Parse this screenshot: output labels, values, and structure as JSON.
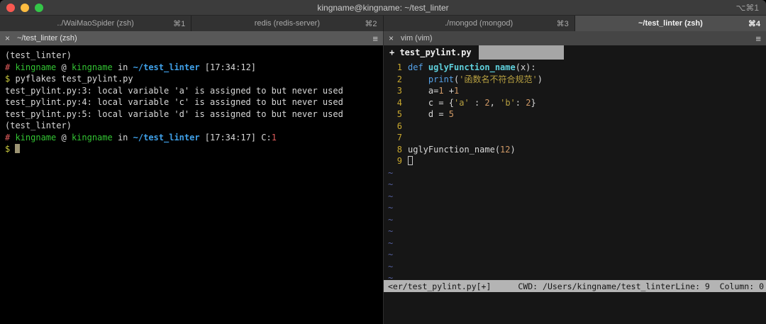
{
  "window": {
    "title": "kingname@kingname: ~/test_linter",
    "shortcut": "⌥⌘1"
  },
  "tabs": [
    {
      "label": "../WaiMaoSpider (zsh)",
      "shortcut": "⌘1",
      "active": false
    },
    {
      "label": "redis (redis-server)",
      "shortcut": "⌘2",
      "active": false
    },
    {
      "label": "./mongod (mongod)",
      "shortcut": "⌘3",
      "active": false
    },
    {
      "label": "~/test_linter (zsh)",
      "shortcut": "⌘4",
      "active": true
    }
  ],
  "left_pane": {
    "title": "~/test_linter (zsh)",
    "close_label": "×",
    "menu_icon": "≡",
    "lines": [
      [
        {
          "t": "(test_linter)",
          "c": "fg"
        }
      ],
      [
        {
          "t": "# ",
          "c": "red"
        },
        {
          "t": "kingname",
          "c": "green"
        },
        {
          "t": " @ ",
          "c": "fg"
        },
        {
          "t": "kingname",
          "c": "green"
        },
        {
          "t": " in ",
          "c": "fg"
        },
        {
          "t": "~/test_linter",
          "c": "path"
        },
        {
          "t": " [17:34:12]",
          "c": "fg"
        }
      ],
      [
        {
          "t": "$",
          "c": "yellow"
        },
        {
          "t": " pyflakes test_pylint.py",
          "c": "fg"
        }
      ],
      [
        {
          "t": "test_pylint.py:3: local variable 'a' is assigned to but never used",
          "c": "fg"
        }
      ],
      [
        {
          "t": "test_pylint.py:4: local variable 'c' is assigned to but never used",
          "c": "fg"
        }
      ],
      [
        {
          "t": "test_pylint.py:5: local variable 'd' is assigned to but never used",
          "c": "fg"
        }
      ],
      [
        {
          "t": "(test_linter)",
          "c": "fg"
        }
      ],
      [
        {
          "t": "# ",
          "c": "red"
        },
        {
          "t": "kingname",
          "c": "green"
        },
        {
          "t": " @ ",
          "c": "fg"
        },
        {
          "t": "kingname",
          "c": "green"
        },
        {
          "t": " in ",
          "c": "fg"
        },
        {
          "t": "~/test_linter",
          "c": "path"
        },
        {
          "t": " [17:34:17] ",
          "c": "fg"
        },
        {
          "t": "C:",
          "c": "fg"
        },
        {
          "t": "1",
          "c": "red"
        }
      ],
      [
        {
          "t": "$",
          "c": "yellow"
        },
        {
          "t": " ",
          "c": "fg"
        },
        {
          "cursor": "block"
        }
      ]
    ]
  },
  "right_pane": {
    "title": "vim (vim)",
    "close_label": "×",
    "menu_icon": "≡",
    "vim": {
      "tab_label": "+ test_pylint.py",
      "code_lines": [
        {
          "num": "1",
          "segs": [
            {
              "t": "def ",
              "c": "kw"
            },
            {
              "t": "uglyFunction_name",
              "c": "func"
            },
            {
              "t": "(x):",
              "c": "fg"
            }
          ]
        },
        {
          "num": "2",
          "segs": [
            {
              "t": "    ",
              "c": "fg"
            },
            {
              "t": "print",
              "c": "kw"
            },
            {
              "t": "(",
              "c": "fg"
            },
            {
              "t": "'函数名不符合规范'",
              "c": "str"
            },
            {
              "t": ")",
              "c": "fg"
            }
          ]
        },
        {
          "num": "3",
          "segs": [
            {
              "t": "    a=",
              "c": "fg"
            },
            {
              "t": "1",
              "c": "num"
            },
            {
              "t": " +",
              "c": "fg"
            },
            {
              "t": "1",
              "c": "num"
            }
          ]
        },
        {
          "num": "4",
          "segs": [
            {
              "t": "    c = {",
              "c": "fg"
            },
            {
              "t": "'a'",
              "c": "str"
            },
            {
              "t": " : ",
              "c": "fg"
            },
            {
              "t": "2",
              "c": "num"
            },
            {
              "t": ", ",
              "c": "fg"
            },
            {
              "t": "'b'",
              "c": "str"
            },
            {
              "t": ": ",
              "c": "fg"
            },
            {
              "t": "2",
              "c": "num"
            },
            {
              "t": "}",
              "c": "fg"
            }
          ]
        },
        {
          "num": "5",
          "segs": [
            {
              "t": "    d = ",
              "c": "fg"
            },
            {
              "t": "5",
              "c": "num"
            }
          ]
        },
        {
          "num": "6",
          "segs": []
        },
        {
          "num": "7",
          "segs": []
        },
        {
          "num": "8",
          "segs": [
            {
              "t": "uglyFunction_name(",
              "c": "fg"
            },
            {
              "t": "12",
              "c": "num"
            },
            {
              "t": ")",
              "c": "fg"
            }
          ]
        },
        {
          "num": "9",
          "segs": [
            {
              "cursor": "hollow"
            }
          ]
        }
      ],
      "tilde_char": "~",
      "tilde_count": 10,
      "status": {
        "file": "<er/test_pylint.py[+]",
        "cwd": "CWD: /Users/kingname/test_linter",
        "position": "Line: 9  Column: 0"
      }
    }
  },
  "palette": {
    "green": "#33c433",
    "red": "#e05c5c",
    "yellow": "#cbcb3e",
    "path_blue": "#3fa0e8",
    "keyword_blue": "#55a1e8",
    "function_cyan": "#5fd0dc",
    "string_khaki": "#b8a141",
    "number_orange": "#d19a66",
    "line_number_yellow": "#c9a82e",
    "tilde_blue": "#5560a0",
    "status_bar_bg": "#b4b4b4",
    "active_tab_bg": "#4f4f4f"
  }
}
